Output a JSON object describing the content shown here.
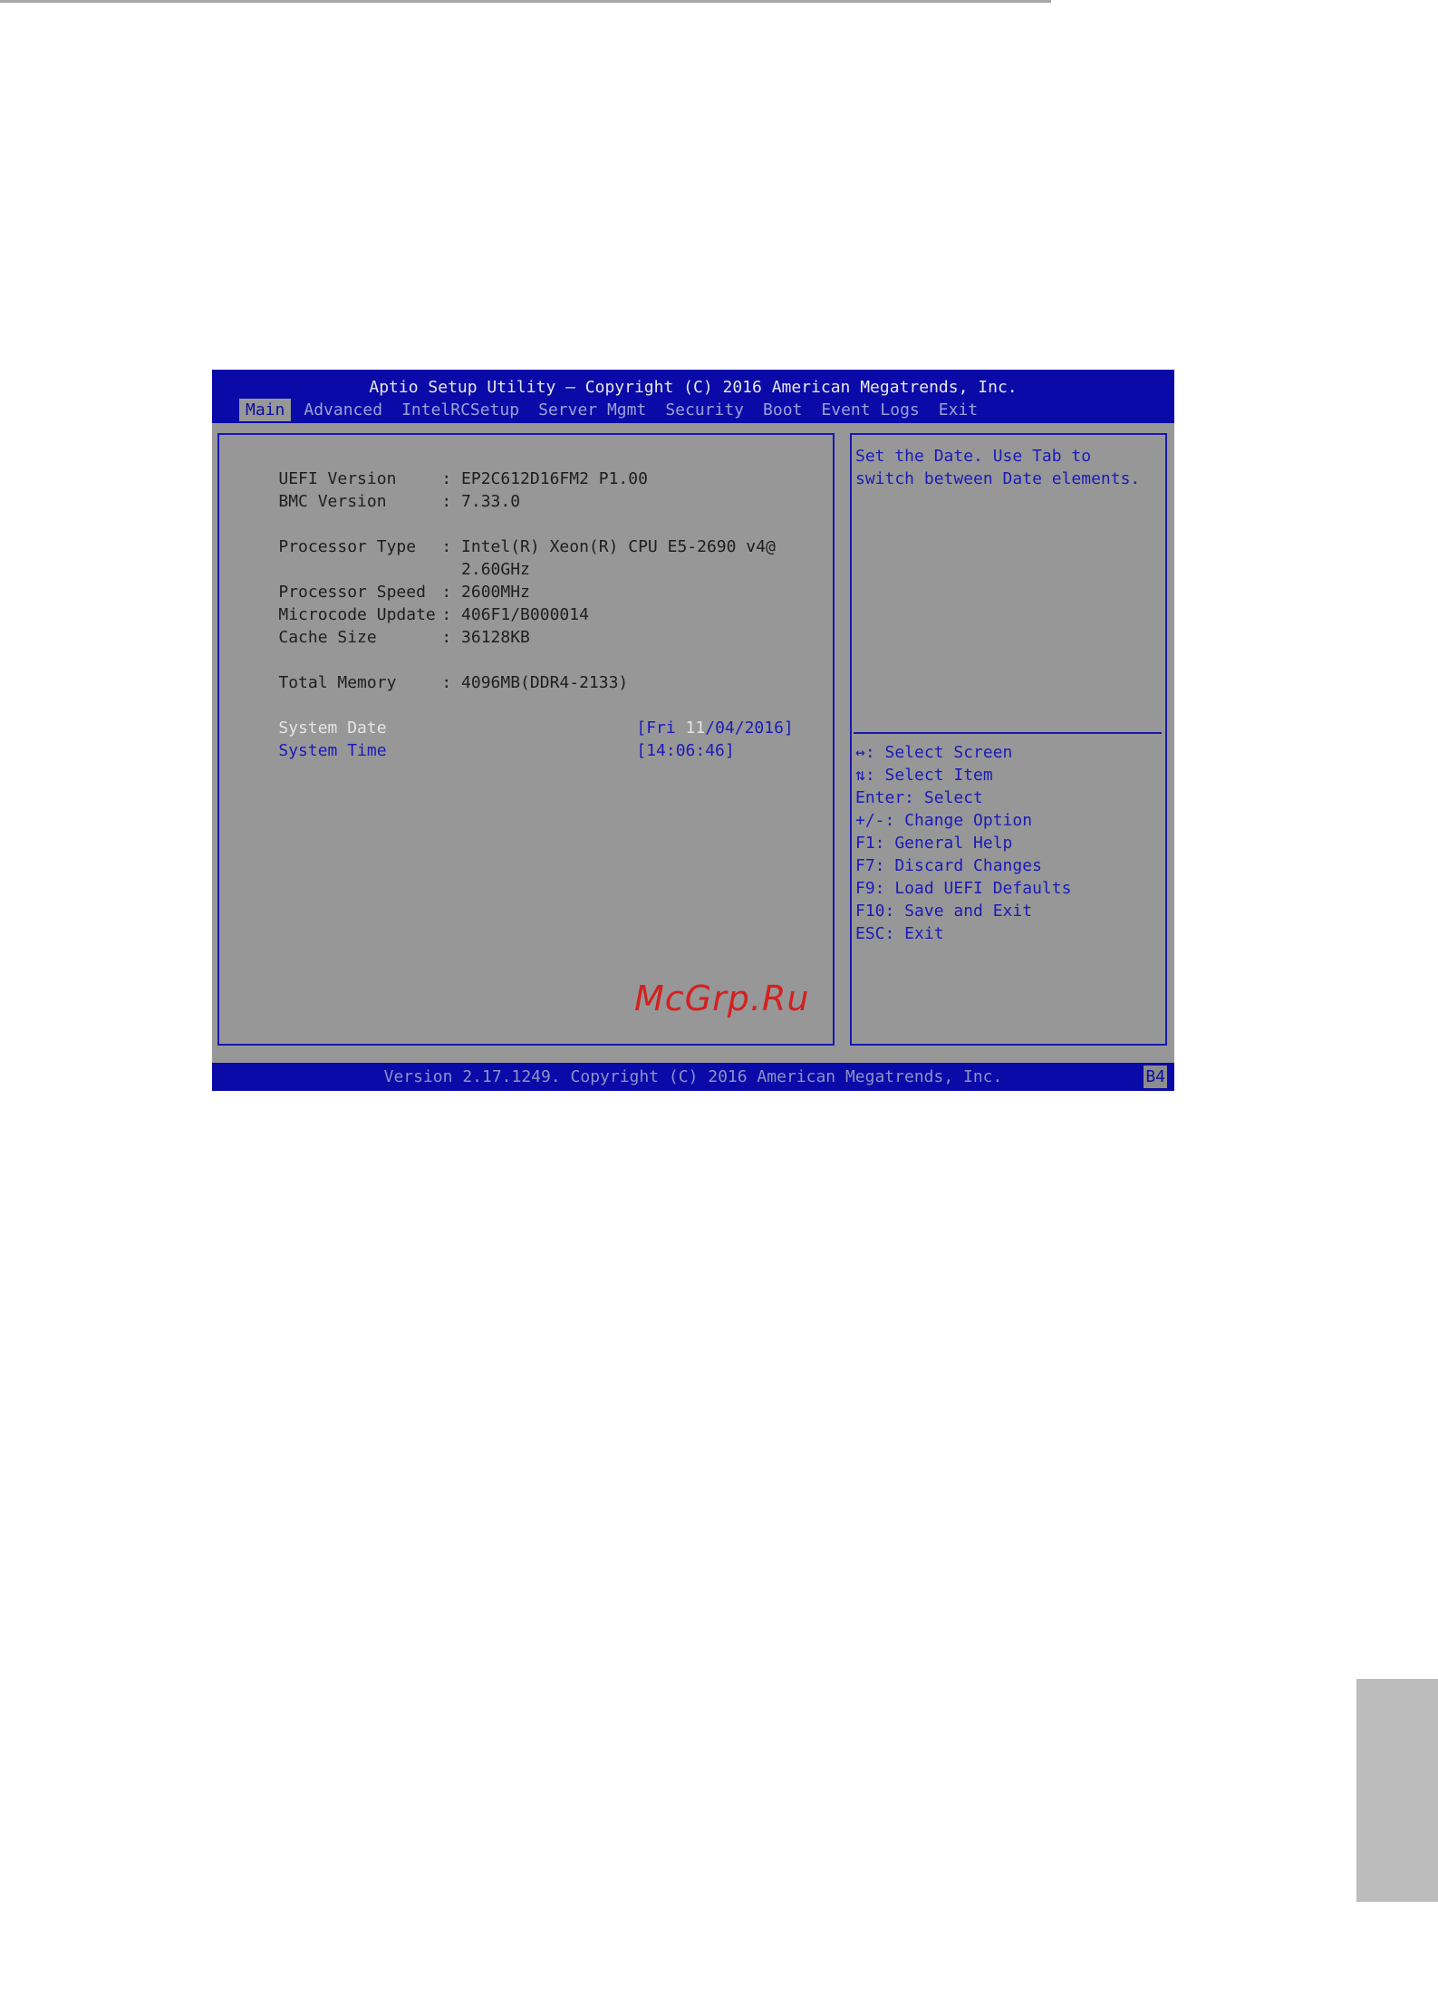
{
  "header": {
    "title": "Aptio Setup Utility – Copyright (C) 2016 American Megatrends, Inc.",
    "tabs": [
      "Main",
      "Advanced",
      "IntelRCSetup",
      "Server Mgmt",
      "Security",
      "Boot",
      "Event Logs",
      "Exit"
    ],
    "active_tab": "Main"
  },
  "info": [
    {
      "label": "UEFI Version",
      "value": ": EP2C612D16FM2 P1.00"
    },
    {
      "label": "BMC Version",
      "value": ": 7.33.0"
    },
    {
      "label": "Processor Type",
      "value": ": Intel(R) Xeon(R) CPU E5-2690 v4@"
    },
    {
      "label": "",
      "value": "  2.60GHz"
    },
    {
      "label": "Processor Speed",
      "value": ": 2600MHz"
    },
    {
      "label": "Microcode Update",
      "value": ": 406F1/B000014"
    },
    {
      "label": "Cache Size",
      "value": ": 36128KB"
    },
    {
      "label": "Total Memory",
      "value": ": 4096MB(DDR4-2133)"
    }
  ],
  "system_date": {
    "label": "System Date",
    "value_prefix": "[Fri ",
    "value_highlight": "11",
    "value_suffix": "/04/2016]"
  },
  "system_time": {
    "label": "System Time",
    "value": "[14:06:46]"
  },
  "help": {
    "description": [
      "Set the Date. Use Tab to",
      "switch between Date elements."
    ],
    "keys": [
      "↔: Select Screen",
      "⇅: Select Item",
      "Enter: Select",
      "+/-: Change Option",
      "F1: General Help",
      "F7: Discard Changes",
      "F9: Load UEFI Defaults",
      "F10: Save and Exit",
      "ESC: Exit"
    ]
  },
  "footer": {
    "text": "Version 2.17.1249. Copyright (C) 2016 American Megatrends, Inc.",
    "badge": "B4"
  },
  "watermark": "McGrp.Ru",
  "colors": {
    "bios_blue": "#0a0aa8",
    "panel_gray": "#979797",
    "link_blue": "#1b1bb8",
    "highlight_white": "#e4e4e4"
  }
}
